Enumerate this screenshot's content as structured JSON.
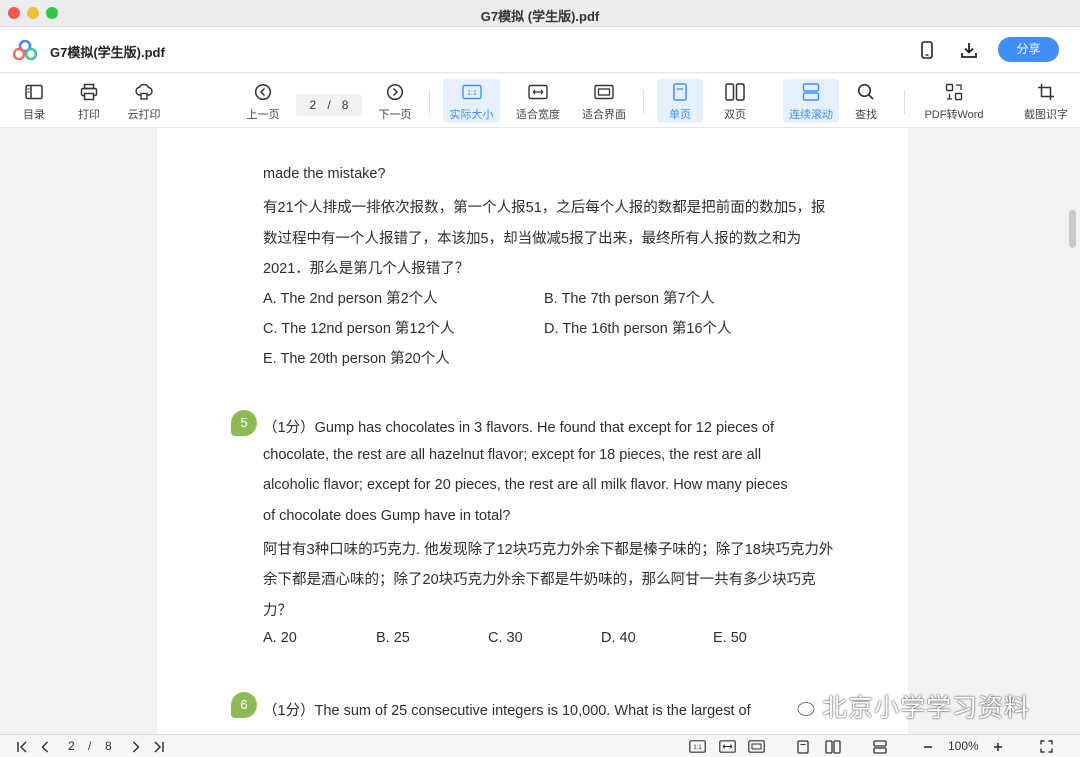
{
  "window": {
    "title": "G7模拟 (学生版).pdf"
  },
  "header": {
    "doc_name": "G7模拟(学生版).pdf",
    "share_label": "分享"
  },
  "toolbar": {
    "toc": "目录",
    "print": "打印",
    "cloud_print": "云打印",
    "prev": "上一页",
    "page_current": "2",
    "page_sep": "/",
    "page_total": "8",
    "next": "下一页",
    "actual_size": "实际大小",
    "actual_size_icon_text": "1:1",
    "fit_width": "适合宽度",
    "fit_page": "适合界面",
    "single": "单页",
    "double": "双页",
    "continuous": "连续滚动",
    "search": "查找",
    "pdf_to_word": "PDF转Word",
    "screenshot_ocr": "截图识字"
  },
  "document": {
    "q4_lines": [
      "made the mistake?",
      "有21个人排成一排依次报数，第一个人报51，之后每个人报的数都是把前面的数加5，报",
      "数过程中有一个人报错了，本该加5，却当做减5报了出来，最终所有人报的数之和为",
      "2021．那么是第几个人报错了？"
    ],
    "q4_options": [
      "A.  The 2nd person 第2个人",
      "B.  The 7th person 第7个人",
      "C.  The 12nd person 第12个人",
      "D.  The 16th person 第16个人",
      "E.  The 20th person 第20个人"
    ],
    "q5_number": "5",
    "q5_lines": [
      "（1分）Gump has chocolates in 3 flavors. He found that except for 12 pieces of",
      "chocolate, the rest are all hazelnut flavor; except for 18 pieces, the rest are all",
      "alcoholic flavor; except for 20 pieces, the rest are all milk flavor. How many pieces",
      "of chocolate does Gump have in total?",
      "阿甘有3种口味的巧克力. 他发现除了12块巧克力外余下都是榛子味的；除了18块巧克力外",
      "余下都是酒心味的；除了20块巧克力外余下都是牛奶味的，那么阿甘一共有多少块巧克",
      "力？"
    ],
    "q5_options": [
      "A.  20",
      "B.  25",
      "C.  30",
      "D.  40",
      "E.  50"
    ],
    "q6_number": "6",
    "q6_line": "（1分）The sum of 25 consecutive integers is 10,000. What is the largest of",
    "watermark": "北京小学学习资料"
  },
  "statusbar": {
    "page_current": "2",
    "page_sep": "/",
    "page_total": "8",
    "zoom": "100%",
    "actual_icon_text": "1:1"
  },
  "colors": {
    "accent": "#3f8ff5",
    "active_bg": "#e6f0fd",
    "question_badge": "#8cbb56"
  }
}
